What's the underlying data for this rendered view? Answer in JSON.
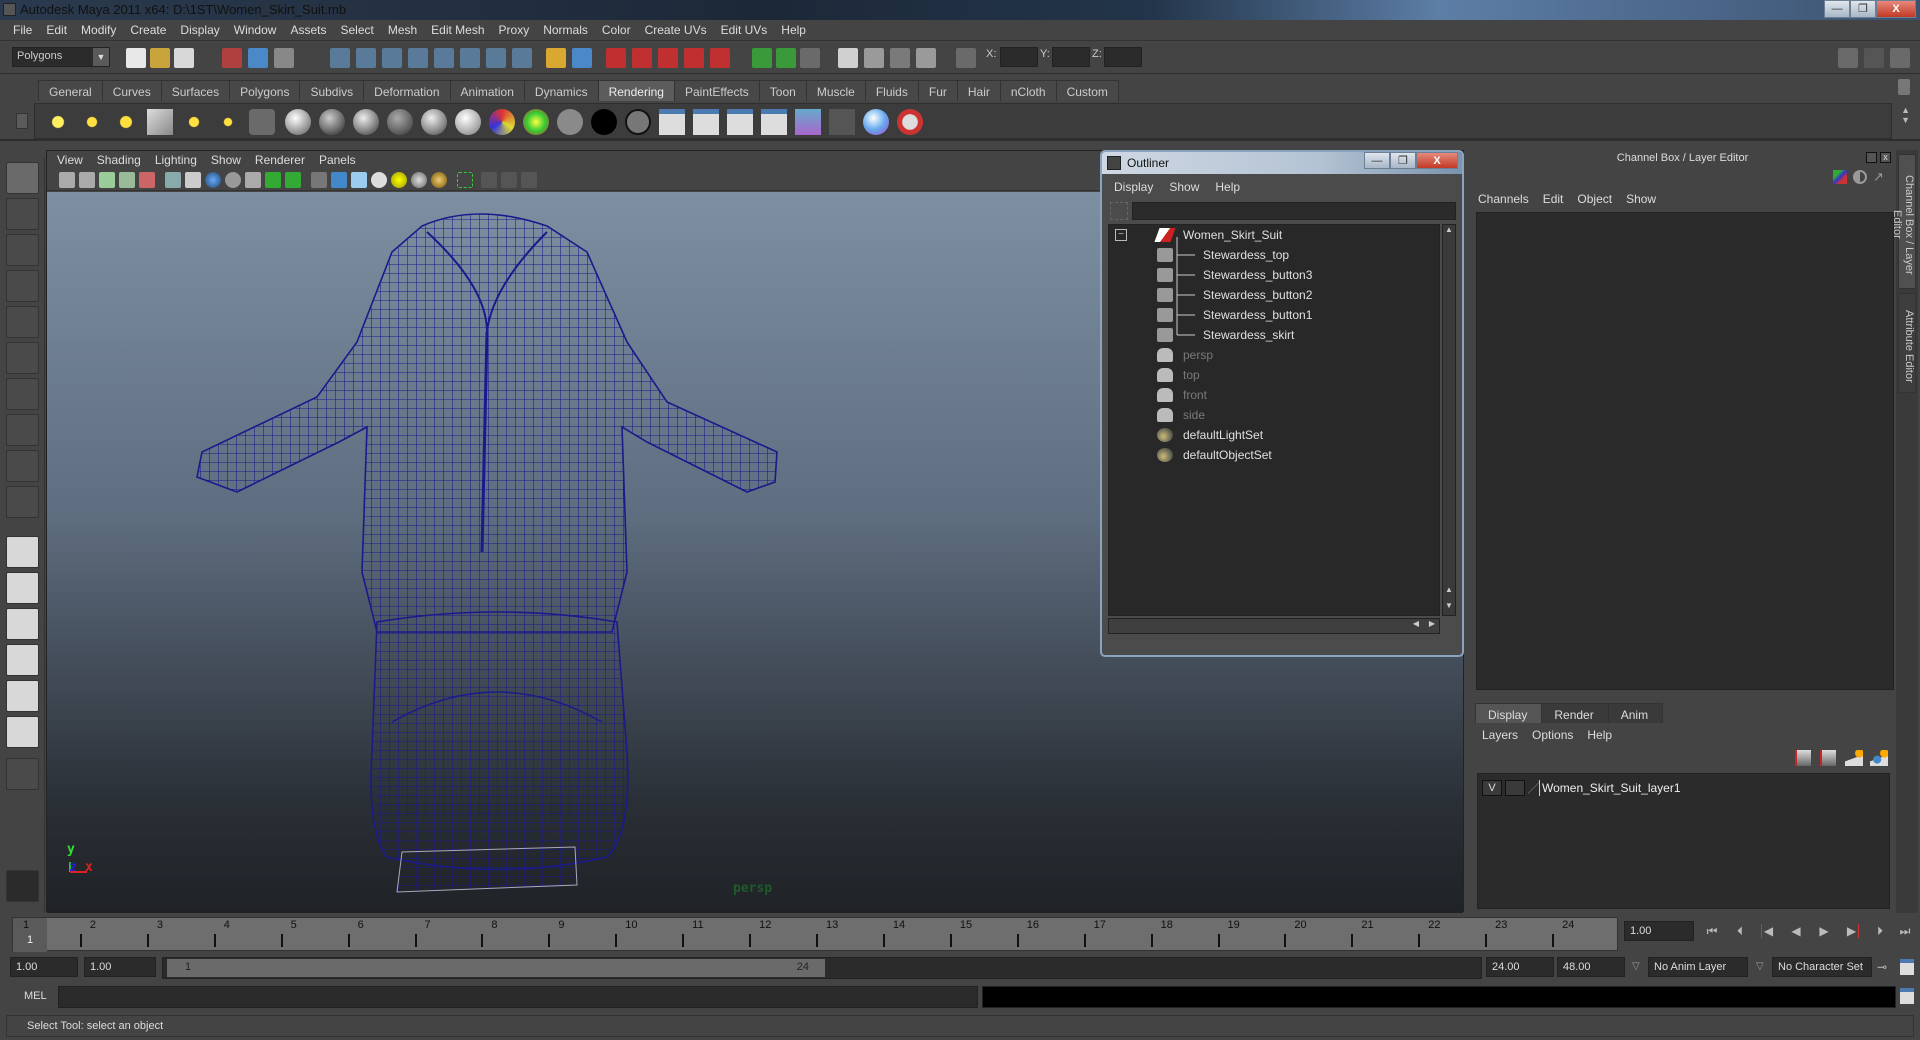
{
  "window": {
    "title": "Autodesk Maya 2011 x64: D:\\1ST\\Women_Skirt_Suit.mb",
    "minimize": "—",
    "maximize": "❐",
    "close": "X"
  },
  "menubar": [
    "File",
    "Edit",
    "Modify",
    "Create",
    "Display",
    "Window",
    "Assets",
    "Select",
    "Mesh",
    "Edit Mesh",
    "Proxy",
    "Normals",
    "Color",
    "Create UVs",
    "Edit UVs",
    "Help"
  ],
  "toolbar": {
    "mode": "Polygons",
    "x_label": "X:",
    "y_label": "Y:",
    "z_label": "Z:",
    "x_value": "",
    "y_value": "",
    "z_value": ""
  },
  "shelf": {
    "tabs": [
      "General",
      "Curves",
      "Surfaces",
      "Polygons",
      "Subdivs",
      "Deformation",
      "Animation",
      "Dynamics",
      "Rendering",
      "PaintEffects",
      "Toon",
      "Muscle",
      "Fluids",
      "Fur",
      "Hair",
      "nCloth",
      "Custom"
    ],
    "active_tab": "Rendering"
  },
  "viewport": {
    "menu": [
      "View",
      "Shading",
      "Lighting",
      "Show",
      "Renderer",
      "Panels"
    ],
    "camera_label": "persp",
    "axis": {
      "x": "x",
      "y": "y",
      "z": "z"
    },
    "model": "Women_Skirt_Suit (wireframe)",
    "wire_color": "#1a1a8c"
  },
  "outliner": {
    "title": "Outliner",
    "menu": [
      "Display",
      "Show",
      "Help"
    ],
    "filter_value": "",
    "items": [
      {
        "label": "Women_Skirt_Suit",
        "type": "group",
        "indent": 0,
        "dim": false,
        "expanded": true
      },
      {
        "label": "Stewardess_top",
        "type": "mesh",
        "indent": 1,
        "dim": false
      },
      {
        "label": "Stewardess_button3",
        "type": "mesh",
        "indent": 1,
        "dim": false
      },
      {
        "label": "Stewardess_button2",
        "type": "mesh",
        "indent": 1,
        "dim": false
      },
      {
        "label": "Stewardess_button1",
        "type": "mesh",
        "indent": 1,
        "dim": false
      },
      {
        "label": "Stewardess_skirt",
        "type": "mesh",
        "indent": 1,
        "dim": false
      },
      {
        "label": "persp",
        "type": "camera",
        "indent": 0,
        "dim": true
      },
      {
        "label": "top",
        "type": "camera",
        "indent": 0,
        "dim": true
      },
      {
        "label": "front",
        "type": "camera",
        "indent": 0,
        "dim": true
      },
      {
        "label": "side",
        "type": "camera",
        "indent": 0,
        "dim": true
      },
      {
        "label": "defaultLightSet",
        "type": "set",
        "indent": 0,
        "dim": false
      },
      {
        "label": "defaultObjectSet",
        "type": "set",
        "indent": 0,
        "dim": false
      }
    ]
  },
  "channel_box": {
    "title": "Channel Box / Layer Editor",
    "menu": [
      "Channels",
      "Edit",
      "Object",
      "Show"
    ],
    "layer_tabs": [
      "Display",
      "Render",
      "Anim"
    ],
    "active_layer_tab": "Display",
    "layer_menu": [
      "Layers",
      "Options",
      "Help"
    ],
    "layers": [
      {
        "visible": "V",
        "playback": "",
        "name": "Women_Skirt_Suit_layer1"
      }
    ]
  },
  "side_tabs": [
    "Channel Box / Layer Editor",
    "Attribute Editor"
  ],
  "timeline": {
    "frames": [
      1,
      2,
      3,
      4,
      5,
      6,
      7,
      8,
      9,
      10,
      11,
      12,
      13,
      14,
      15,
      16,
      17,
      18,
      19,
      20,
      21,
      22,
      23,
      24
    ],
    "current_frame": "1",
    "current_time": "1.00"
  },
  "playback": [
    "go-to-start",
    "step-back-key",
    "step-back-frame",
    "play-back",
    "play-forward",
    "step-forward-frame",
    "step-forward-key",
    "go-to-end"
  ],
  "range": {
    "start_time": "1.00",
    "playback_start": "1.00",
    "slider_start": "1",
    "slider_end": "24",
    "playback_end": "24.00",
    "end_time": "48.00",
    "anim_layer": "No Anim Layer",
    "character_set": "No Character Set"
  },
  "command_line": {
    "label": "MEL",
    "value": ""
  },
  "help_line": "Select Tool: select an object"
}
